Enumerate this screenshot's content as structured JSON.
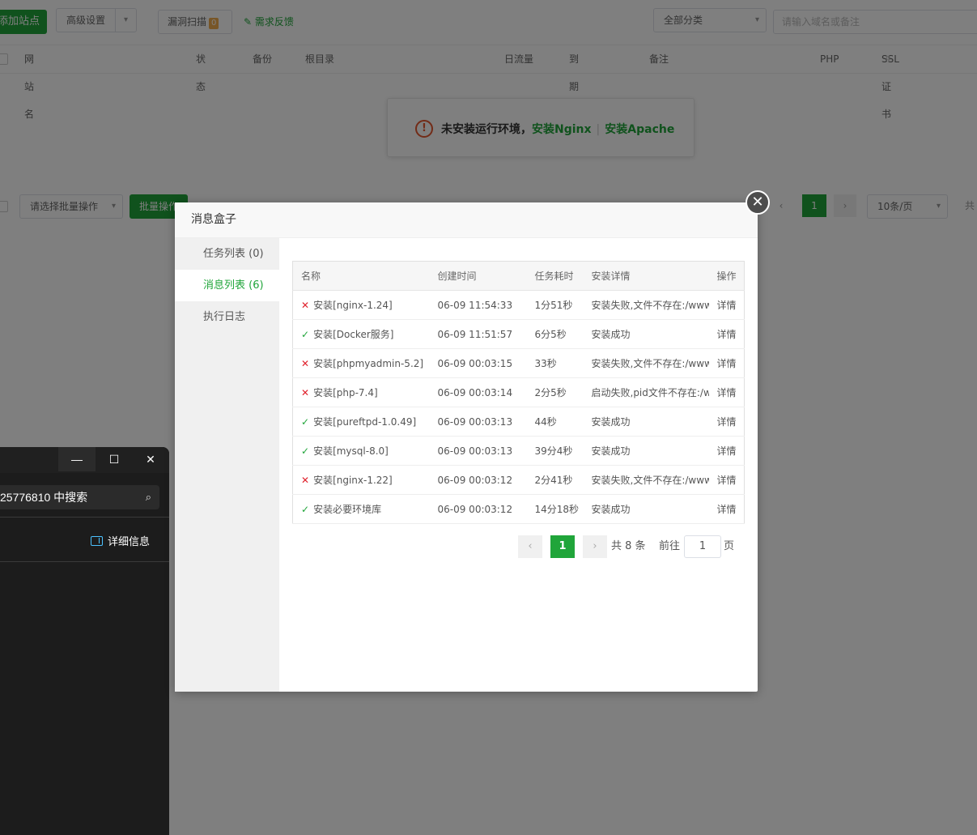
{
  "background": {
    "toolbar": {
      "add_site": "添加站点",
      "advanced": "高级设置",
      "scan": "漏洞扫描",
      "scan_count": "0",
      "feedback": "需求反馈",
      "category": "全部分类",
      "search_placeholder": "请输入域名或备注"
    },
    "columns": [
      "网站名",
      "状态",
      "备份",
      "根目录",
      "日流量",
      "到期时间",
      "备注",
      "PHP",
      "SSL证书"
    ],
    "notice": {
      "text": "未安装运行环境，",
      "link_nginx": "安装Nginx",
      "link_apache": "安装Apache"
    },
    "footer": {
      "batch_select": "请选择批量操作",
      "batch_button": "批量操作",
      "page": "1",
      "page_size": "10条/页",
      "total_prefix": "共"
    }
  },
  "explorer": {
    "search_text": "25776810 中搜索",
    "details": "详细信息"
  },
  "modal": {
    "title": "消息盒子",
    "tabs": [
      {
        "label": "任务列表 (0)"
      },
      {
        "label": "消息列表 (6)"
      },
      {
        "label": "执行日志"
      }
    ],
    "table": {
      "headers": [
        "名称",
        "创建时间",
        "任务耗时",
        "安装详情",
        "操作"
      ],
      "rows": [
        {
          "status": "fail",
          "name": "安装[nginx-1.24]",
          "time": "06-09 11:54:33",
          "duration": "1分51秒",
          "detail": "安装失败,文件不存在:/www/server/nginx",
          "op": "详情"
        },
        {
          "status": "ok",
          "name": "安装[Docker服务]",
          "time": "06-09 11:51:57",
          "duration": "6分5秒",
          "detail": "安装成功",
          "op": "详情"
        },
        {
          "status": "fail",
          "name": "安装[phpmyadmin-5.2]",
          "time": "06-09 00:03:15",
          "duration": "33秒",
          "detail": "安装失败,文件不存在:/www/server/phpmyadmin",
          "op": "详情"
        },
        {
          "status": "fail",
          "name": "安装[php-7.4]",
          "time": "06-09 00:03:14",
          "duration": "2分5秒",
          "detail": "启动失败,pid文件不存在:/www/server/php",
          "op": "详情"
        },
        {
          "status": "ok",
          "name": "安装[pureftpd-1.0.49]",
          "time": "06-09 00:03:13",
          "duration": "44秒",
          "detail": "安装成功",
          "op": "详情"
        },
        {
          "status": "ok",
          "name": "安装[mysql-8.0]",
          "time": "06-09 00:03:13",
          "duration": "39分4秒",
          "detail": "安装成功",
          "op": "详情"
        },
        {
          "status": "fail",
          "name": "安装[nginx-1.22]",
          "time": "06-09 00:03:12",
          "duration": "2分41秒",
          "detail": "安装失败,文件不存在:/www/server/nginx",
          "op": "详情"
        },
        {
          "status": "ok",
          "name": "安装必要环境库",
          "time": "06-09 00:03:12",
          "duration": "14分18秒",
          "detail": "安装成功",
          "op": "详情"
        }
      ]
    },
    "pager": {
      "prev": "‹",
      "current": "1",
      "next": "›",
      "total": "共 8 条",
      "goto_label": "前往",
      "goto_value": "1",
      "goto_suffix": "页"
    }
  },
  "colors": {
    "accent": "#20a53a",
    "error": "#e0222d",
    "overlay": "rgba(0,0,0,0.5)"
  }
}
